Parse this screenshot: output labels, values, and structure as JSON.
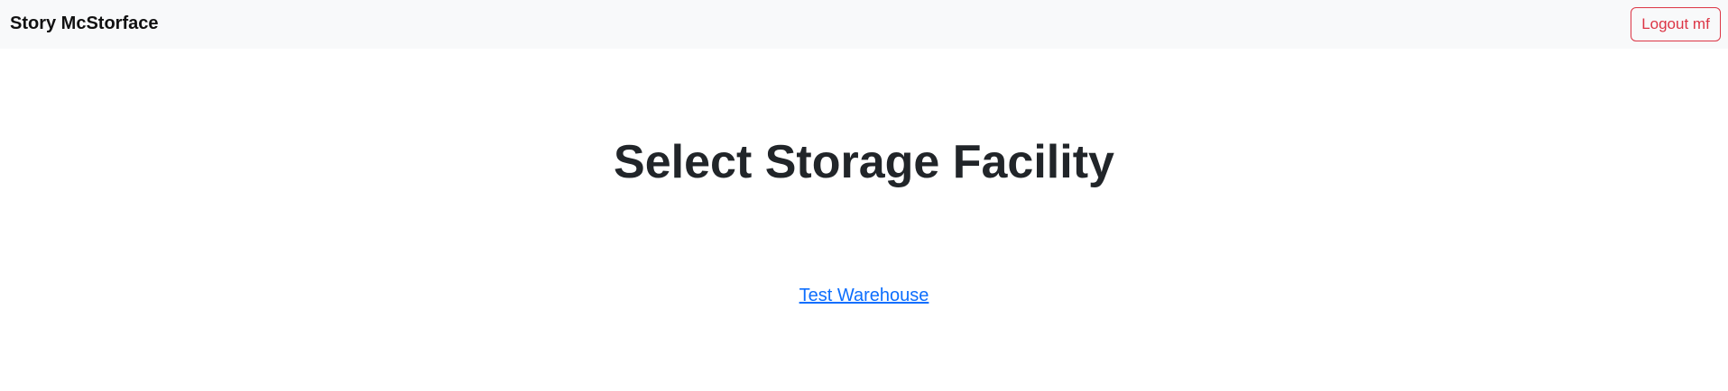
{
  "navbar": {
    "brand": "Story McStorface",
    "logout_label": "Logout mf"
  },
  "main": {
    "title": "Select Storage Facility",
    "facilities": [
      {
        "label": "Test Warehouse"
      }
    ]
  },
  "colors": {
    "navbar_background": "#f8f9fa",
    "logout_accent": "#dc3545",
    "link": "#0d6efd",
    "heading": "#212529"
  }
}
